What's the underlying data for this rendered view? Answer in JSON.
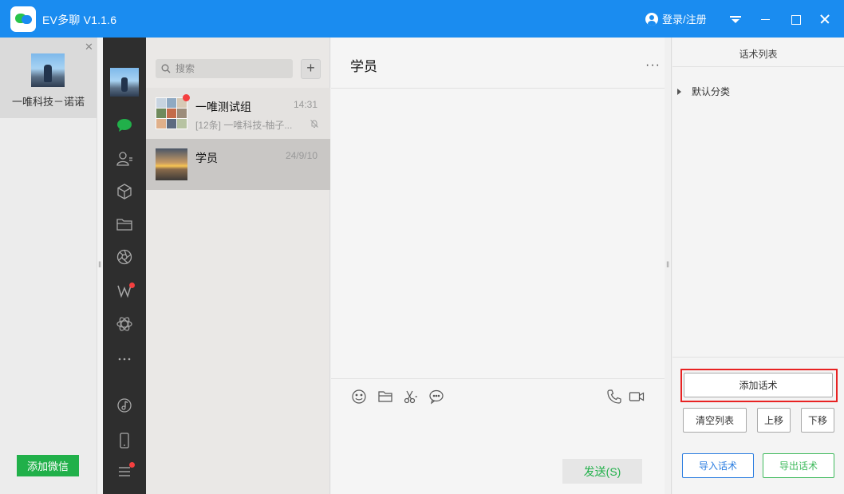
{
  "titlebar": {
    "app_title": "EV多聊  V1.1.6",
    "login_label": "登录/注册",
    "brand_color": "#1a8cf0"
  },
  "account_panel": {
    "account_name": "一唯科技－诺诺",
    "add_wechat_label": "添加微信"
  },
  "iconbar": {
    "icons": [
      "chat-icon",
      "contacts-icon",
      "cube-icon",
      "folder-icon",
      "aperture-icon",
      "w-app-icon",
      "atom-icon",
      "more-icon",
      "music-note-icon",
      "phone-icon",
      "menu-icon"
    ]
  },
  "conversation_list": {
    "search_placeholder": "搜索",
    "add_label": "+",
    "items": [
      {
        "name": "一唯测试组",
        "time": "14:31",
        "preview": "[12条] 一唯科技-柚子...",
        "muted": true,
        "unread_dot": true
      },
      {
        "name": "学员",
        "time": "24/9/10",
        "preview": "",
        "selected": true
      }
    ]
  },
  "chat": {
    "title": "学员",
    "more_label": "···",
    "send_label": "发送(S)",
    "tools": [
      "emoji-icon",
      "folder-icon",
      "scissors-icon",
      "comment-icon",
      "phone-call-icon",
      "video-call-icon"
    ]
  },
  "phrases_panel": {
    "title": "话术列表",
    "category": "默认分类",
    "add_label": "添加话术",
    "clear_label": "清空列表",
    "move_up_label": "上移",
    "move_down_label": "下移",
    "import_label": "导入话术",
    "export_label": "导出话术",
    "highlight_color": "#e82222"
  }
}
